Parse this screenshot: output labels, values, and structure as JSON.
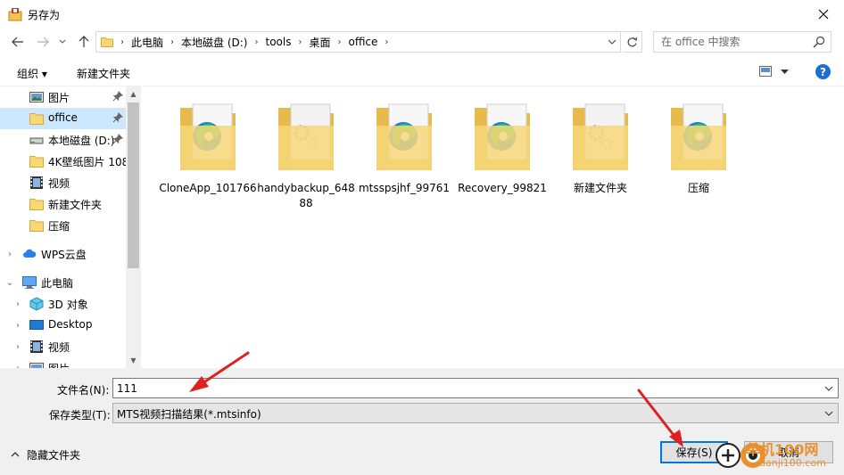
{
  "window": {
    "title": "另存为"
  },
  "address": {
    "crumbs": [
      "此电脑",
      "本地磁盘 (D:)",
      "tools",
      "桌面",
      "office"
    ]
  },
  "search": {
    "placeholder": "在 office 中搜索"
  },
  "toolbar": {
    "organize_label": "组织 ▾",
    "new_folder_label": "新建文件夹"
  },
  "nav": {
    "items": [
      {
        "label": "图片",
        "icon": "pictures-icon",
        "pinned": true
      },
      {
        "label": "office",
        "icon": "folder-icon",
        "pinned": true,
        "selected": true
      },
      {
        "label": "本地磁盘 (D:)",
        "icon": "drive-icon",
        "pinned": true
      },
      {
        "label": "4K壁纸图片 108",
        "icon": "folder-icon"
      },
      {
        "label": "视频",
        "icon": "videos-icon"
      },
      {
        "label": "新建文件夹",
        "icon": "folder-icon"
      },
      {
        "label": "压缩",
        "icon": "folder-icon"
      },
      {
        "label": "WPS云盘",
        "icon": "cloud-icon"
      },
      {
        "label": "此电脑",
        "icon": "computer-icon"
      },
      {
        "label": "3D 对象",
        "icon": "3d-objects-icon"
      },
      {
        "label": "Desktop",
        "icon": "desktop-icon"
      },
      {
        "label": "视频",
        "icon": "videos-icon"
      },
      {
        "label": "图片",
        "icon": "pictures-icon"
      }
    ]
  },
  "files": [
    {
      "name": "CloneApp_101766",
      "thumb": "edge-folder-icon"
    },
    {
      "name": "handybackup_64888",
      "thumb": "settings-folder-icon"
    },
    {
      "name": "mtsspsjhf_99761",
      "thumb": "edge-folder-icon"
    },
    {
      "name": "Recovery_99821",
      "thumb": "edge-folder-icon"
    },
    {
      "name": "新建文件夹",
      "thumb": "settings-folder-icon"
    },
    {
      "name": "压缩",
      "thumb": "edge-folder-icon"
    }
  ],
  "form": {
    "filename_label": "文件名(N):",
    "filename_value": "111",
    "filetype_label": "保存类型(T):",
    "filetype_value": "MTS视频扫描结果(*.mtsinfo)"
  },
  "footer": {
    "hide_folders_label": "隐藏文件夹",
    "save_label": "保存(S)",
    "cancel_label": "取消"
  },
  "watermark": {
    "line1": "单机100网",
    "line2": "danji100.com"
  },
  "colors": {
    "selection": "#cce8ff",
    "accent": "#0078d7",
    "annotation_arrow": "#e02020",
    "watermark": "#e8912e"
  }
}
